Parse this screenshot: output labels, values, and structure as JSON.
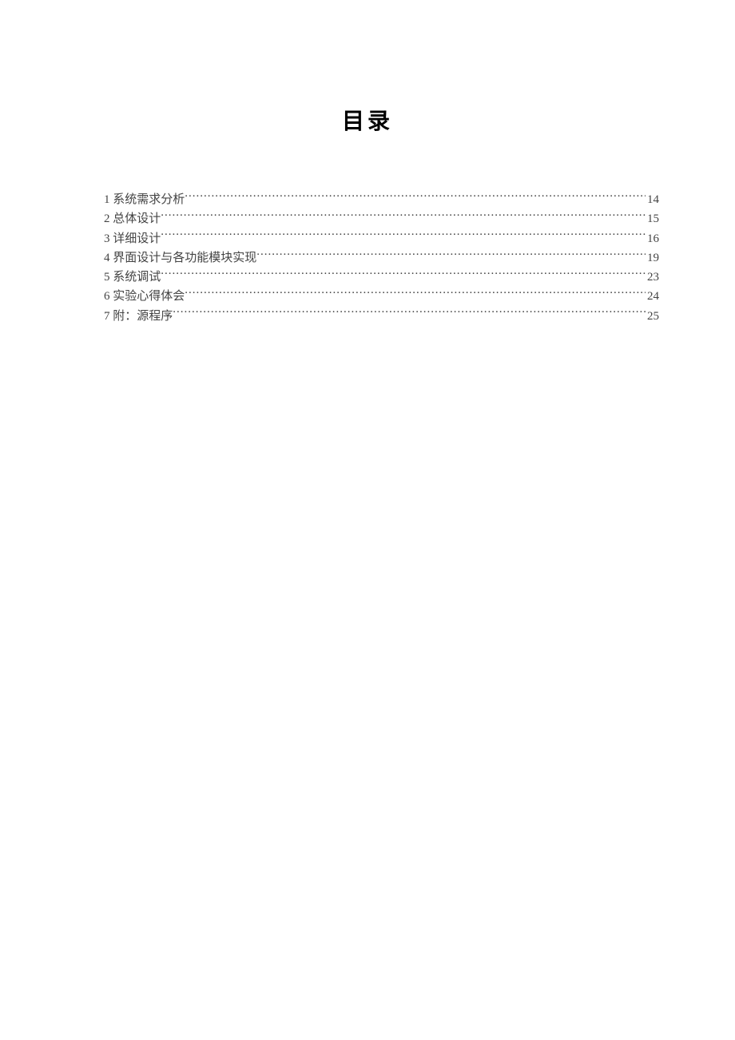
{
  "title": "目录",
  "toc": [
    {
      "label": "1 系统需求分析",
      "page": "14"
    },
    {
      "label": "2 总体设计",
      "page": "15"
    },
    {
      "label": "3 详细设计",
      "page": "16"
    },
    {
      "label": "4 界面设计与各功能模块实现",
      "page": "19"
    },
    {
      "label": "5  系统调试",
      "page": "23"
    },
    {
      "label": "6  实验心得体会",
      "page": "24"
    },
    {
      "label": "7 附：源程序",
      "page": "25"
    }
  ]
}
